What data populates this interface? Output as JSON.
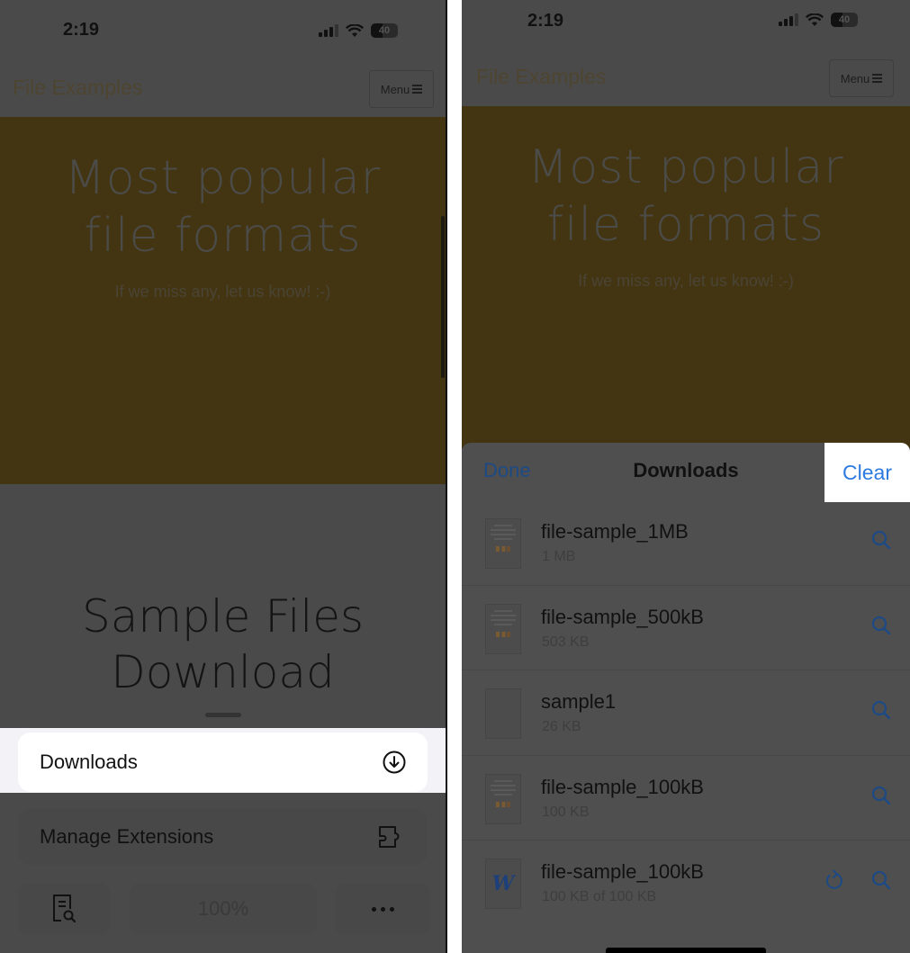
{
  "left": {
    "status": {
      "time": "2:19",
      "battery": "40"
    },
    "site": {
      "logo": "File Examples",
      "menu_label": "Menu"
    },
    "hero": {
      "title": "Most popular file formats",
      "subtitle": "If we miss any, let us know! :-)"
    },
    "section_title": "Sample Files Download",
    "menu": {
      "downloads_label": "Downloads",
      "extensions_label": "Manage Extensions",
      "zoom_level": "100%"
    }
  },
  "right": {
    "status": {
      "time": "2:19",
      "battery": "40"
    },
    "site": {
      "logo": "File Examples",
      "menu_label": "Menu"
    },
    "hero": {
      "title": "Most popular file formats",
      "subtitle": "If we miss any, let us know! :-)"
    },
    "downloads": {
      "done_label": "Done",
      "title": "Downloads",
      "clear_label": "Clear",
      "items": [
        {
          "name": "file-sample_1MB",
          "size": "1 MB",
          "thumb": "document",
          "in_progress": false
        },
        {
          "name": "file-sample_500kB",
          "size": "503 KB",
          "thumb": "document",
          "in_progress": false
        },
        {
          "name": "sample1",
          "size": "26 KB",
          "thumb": "blank",
          "in_progress": false
        },
        {
          "name": "file-sample_100kB",
          "size": "100 KB",
          "thumb": "document",
          "in_progress": false
        },
        {
          "name": "file-sample_100kB",
          "size": "100 KB of 100 KB",
          "thumb": "word",
          "in_progress": true
        }
      ]
    }
  },
  "colors": {
    "accent_blue": "#2d7ae0",
    "dim_blue": "#1d4a85",
    "hero_bg": "#433511",
    "overlay_bg": "#4a4a4a"
  }
}
